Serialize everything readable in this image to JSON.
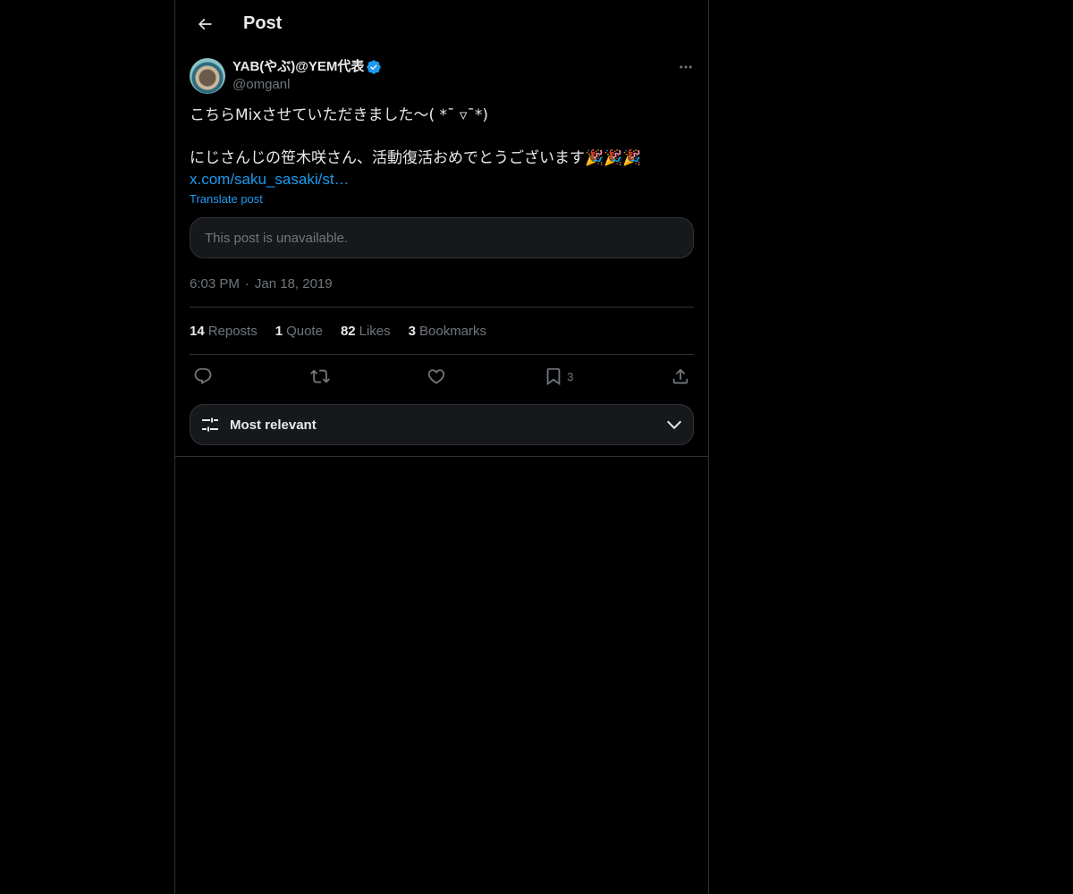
{
  "header": {
    "title": "Post"
  },
  "post": {
    "author": {
      "display_name": "YAB(やぶ)@YEM代表",
      "handle": "@omganl",
      "verified": true
    },
    "text_lines": [
      "こちらMixさせていただきました〜( *¯ ▿¯*)",
      "",
      "にじさんじの笹木咲さん、活動復活おめでとうございます🎉🎉🎉"
    ],
    "link_text": "x.com/saku_sasaki/st…",
    "translate_label": "Translate post",
    "quoted_unavailable": "This post is unavailable.",
    "time": "6:03 PM",
    "date": "Jan 18, 2019",
    "separator": "·"
  },
  "stats": {
    "reposts": {
      "num": "14",
      "label": "Reposts"
    },
    "quotes": {
      "num": "1",
      "label": "Quote"
    },
    "likes": {
      "num": "82",
      "label": "Likes"
    },
    "bookmarks": {
      "num": "3",
      "label": "Bookmarks"
    }
  },
  "actions": {
    "reply": "reply-icon",
    "repost": "repost-icon",
    "like": "heart-icon",
    "bookmark_count": "3",
    "share": "share-icon"
  },
  "sort": {
    "label": "Most relevant"
  },
  "colors": {
    "background": "#000000",
    "text": "#e7e9ea",
    "muted": "#71767b",
    "accent": "#1d9bf0",
    "border": "#2f3336"
  }
}
